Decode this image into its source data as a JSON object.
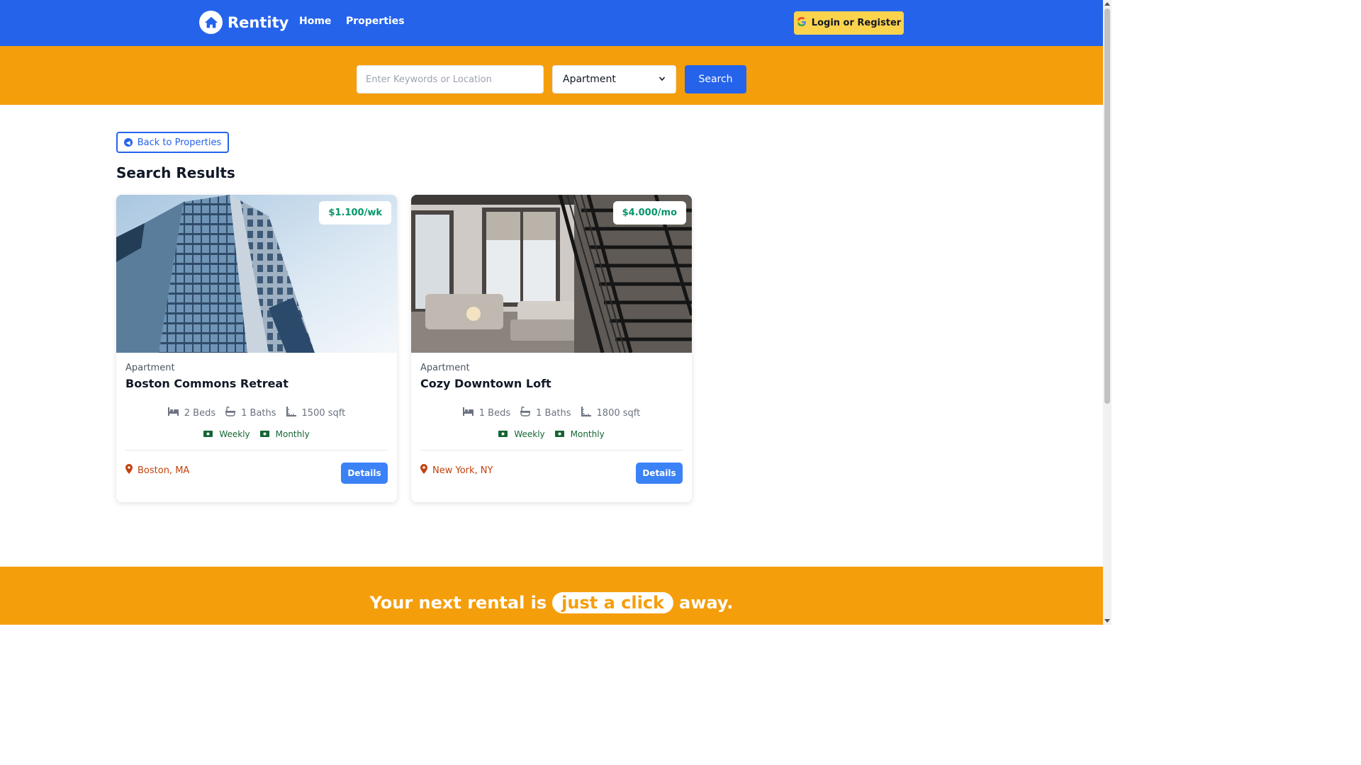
{
  "brand": {
    "name": "Rentity"
  },
  "nav": {
    "links": [
      "Home",
      "Properties"
    ],
    "login_label": "Login or Register"
  },
  "search": {
    "placeholder": "Enter Keywords or Location",
    "type_selected": "Apartment",
    "button_label": "Search"
  },
  "main": {
    "back_label": "Back to Properties",
    "title": "Search Results",
    "cards": [
      {
        "price": "$1.100/wk",
        "type": "Apartment",
        "title": "Boston Commons Retreat",
        "beds": "2 Beds",
        "baths": "1 Baths",
        "sqft": "1500 sqft",
        "rates": [
          "Weekly",
          "Monthly"
        ],
        "location": "Boston, MA",
        "details_label": "Details"
      },
      {
        "price": "$4.000/mo",
        "type": "Apartment",
        "title": "Cozy Downtown Loft",
        "beds": "1 Beds",
        "baths": "1 Baths",
        "sqft": "1800 sqft",
        "rates": [
          "Weekly",
          "Monthly"
        ],
        "location": "New York, NY",
        "details_label": "Details"
      }
    ]
  },
  "footer": {
    "tagline_before": "Your next rental is",
    "tagline_highlight": "just a click",
    "tagline_after": "away."
  },
  "colors": {
    "primary": "#2563eb",
    "accent": "#f59e0b",
    "login_bg": "#fcd34d",
    "price": "#059669",
    "location": "#c2410c"
  },
  "icons": {
    "logo": "house-icon",
    "login": "google-icon",
    "back": "arrow-left-circle-icon",
    "beds": "bed-icon",
    "baths": "bath-icon",
    "sqft": "ruler-icon",
    "rate": "money-icon",
    "location": "map-pin-icon"
  }
}
